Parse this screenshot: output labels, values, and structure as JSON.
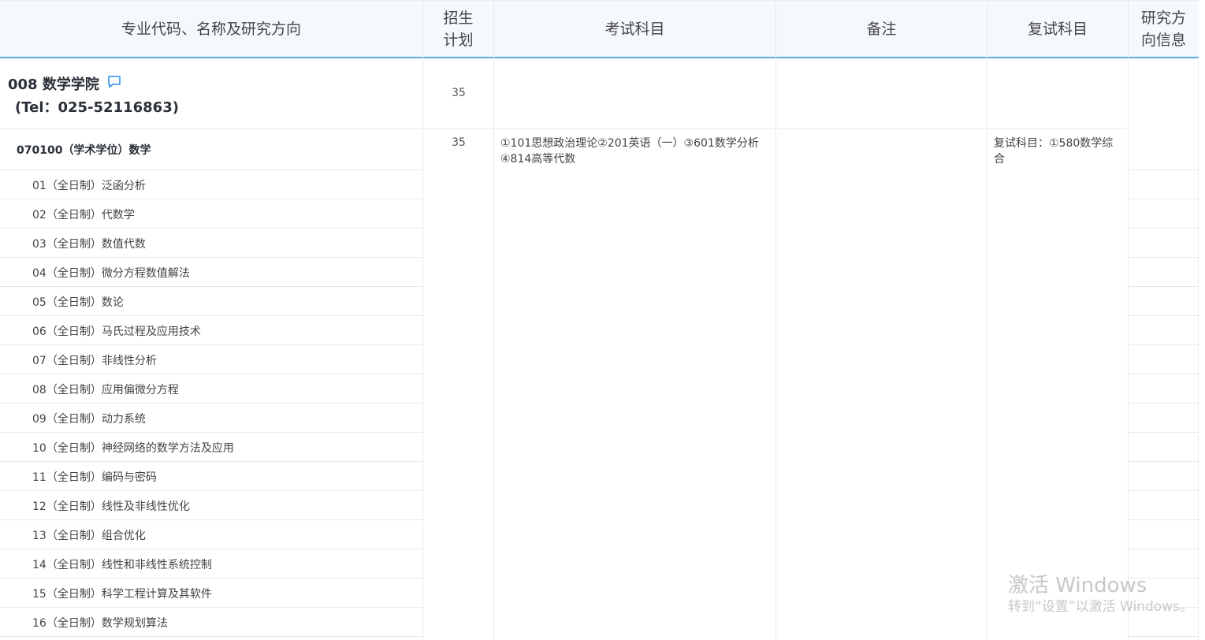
{
  "header": {
    "col_major": "专业代码、名称及研究方向",
    "col_plan": "招生\n计划",
    "col_exam": "考试科目",
    "col_note": "备注",
    "col_retest": "复试科目",
    "col_research": "研究方\n向信息"
  },
  "department": {
    "name": "008 数学学院",
    "tel": "(Tel：025-52116863)",
    "plan": "35"
  },
  "major": {
    "name": "070100（学术学位）数学",
    "plan": "35",
    "exam": "①101思想政治理论②201英语（一）③601数学分析④814高等代数",
    "retest": "复试科目：①580数学综合"
  },
  "directions": [
    "01（全日制）泛函分析",
    "02（全日制）代数学",
    "03（全日制）数值代数",
    "04（全日制）微分方程数值解法",
    "05（全日制）数论",
    "06（全日制）马氏过程及应用技术",
    "07（全日制）非线性分析",
    "08（全日制）应用偏微分方程",
    "09（全日制）动力系统",
    "10（全日制）神经网络的数学方法及应用",
    "11（全日制）编码与密码",
    "12（全日制）线性及非线性优化",
    "13（全日制）组合优化",
    "14（全日制）线性和非线性系统控制",
    "15（全日制）科学工程计算及其软件",
    "16（全日制）数学规划算法"
  ],
  "watermark": {
    "line1": "激活 Windows",
    "line2": "转到“设置”以激活 Windows。"
  },
  "colors": {
    "header_bg": "#f5f9fd",
    "header_border": "#5aace0",
    "accent_icon": "#2d8cf0",
    "grid": "#e7e9ec"
  }
}
